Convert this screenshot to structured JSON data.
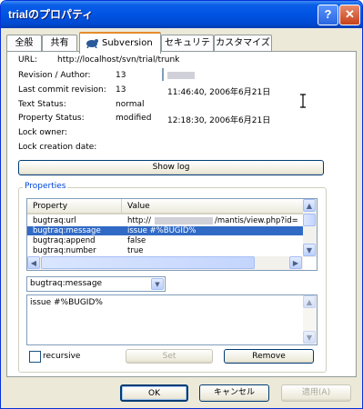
{
  "window": {
    "title": "trialのプロパティ",
    "help_glyph": "?",
    "close_glyph": "✕"
  },
  "tabs": [
    {
      "label": "全般"
    },
    {
      "label": "共有"
    },
    {
      "label": "Subversion",
      "icon": "tortoise-icon",
      "active": true
    },
    {
      "label": "セキュリティ"
    },
    {
      "label": "カスタマイズ"
    }
  ],
  "info": {
    "url_label": "URL:",
    "url_value": "http://localhost/svn/trial/trunk",
    "revision_label": "Revision / Author:",
    "revision_value": "13",
    "last_commit_label": "Last commit revision:",
    "last_commit_value": "13",
    "last_commit_date": "11:46:40, 2006年6月21日",
    "text_status_label": "Text Status:",
    "text_status_value": "normal",
    "prop_status_label": "Property Status:",
    "prop_status_value": "modified",
    "prop_status_date": "12:18:30, 2006年6月21日",
    "lock_owner_label": "Lock owner:",
    "lock_date_label": "Lock creation date:"
  },
  "show_log_label": "Show log",
  "properties": {
    "group_title": "Properties",
    "columns": [
      "Property",
      "Value"
    ],
    "rows": [
      {
        "property": "bugtraq:url",
        "value": "http://",
        "value_tail": "/mantis/view.php?id="
      },
      {
        "property": "bugtraq:message",
        "value": "issue #%BUGID%",
        "selected": true
      },
      {
        "property": "bugtraq:append",
        "value": "false"
      },
      {
        "property": "bugtraq:number",
        "value": "true"
      }
    ],
    "combo_value": "bugtraq:message",
    "value_text": "issue #%BUGID%",
    "recursive_label": "recursive",
    "set_label": "Set",
    "remove_label": "Remove"
  },
  "footer": {
    "ok_label": "OK",
    "cancel_label": "キャンセル",
    "apply_label": "適用(A)"
  },
  "colors": {
    "title_bar": "#0054e3",
    "selection": "#316ac5",
    "group_title": "#0046d5",
    "active_tab_accent": "#e68b2c"
  }
}
